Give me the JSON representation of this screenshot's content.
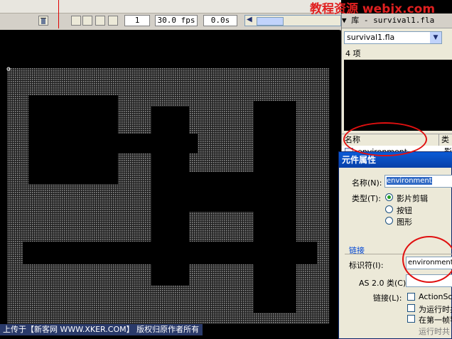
{
  "watermark": "教程资源  webjx.com",
  "timeline": {
    "frame": "1",
    "fps": "30.0 fps",
    "time": "0.0s"
  },
  "caption": "上传于【新客网 WWW.XKER.COM】 版权归原作者所有",
  "library": {
    "title": "▼ 库 - survival1.fla",
    "document": "survival1.fla",
    "item_count": "4 项",
    "col_name": "名称",
    "col_type": "类型",
    "item_name": "environment",
    "item_type": "影"
  },
  "dialog": {
    "title": "元件属性",
    "name_label": "名称(N):",
    "name_value": "environment",
    "type_label": "类型(T):",
    "types": [
      "影片剪辑",
      "按钮",
      "图形"
    ],
    "selected_type": "影片剪辑",
    "linkage_group": "链接",
    "identifier_label": "标识符(I):",
    "identifier_value": "environment",
    "as2_label": "AS 2.0 类(C):",
    "linkage_label": "链接(L):",
    "linkage_options": [
      "ActionSc",
      "为运行时共",
      "在第一帧导",
      "运行时共"
    ]
  },
  "colors": {
    "selection": "#316ac5",
    "annotation": "#e01010",
    "title_bar": "#0a5bd6"
  }
}
